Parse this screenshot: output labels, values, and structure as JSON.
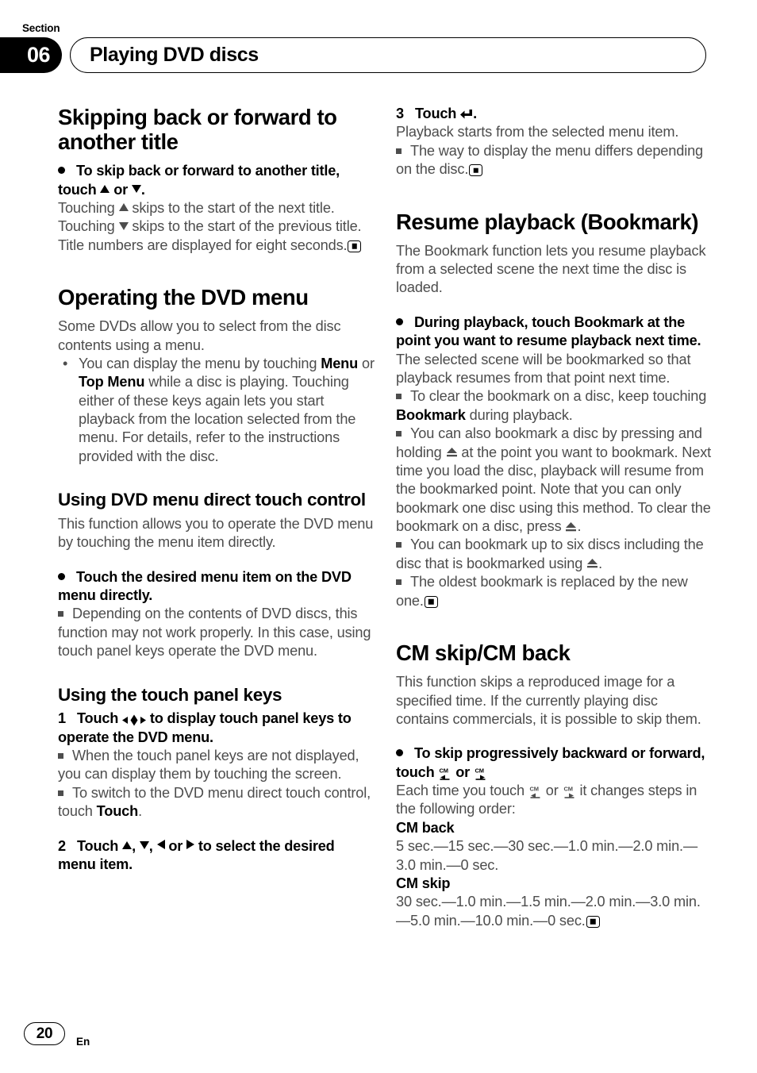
{
  "header": {
    "section_label": "Section",
    "section_number": "06",
    "title": "Playing DVD discs"
  },
  "footer": {
    "page_number": "20",
    "language": "En"
  },
  "icons": {
    "dpad": "dpad-4way-icon",
    "enter": "enter-return-icon",
    "eject": "eject-icon",
    "cm_back": "cm-back-icon",
    "cm_skip": "cm-skip-icon",
    "end_marker": "end-of-section-marker"
  },
  "colors": {
    "body_text": "#4d4d4d",
    "heading_text": "#000000",
    "tab_background": "#000000",
    "page_background": "#ffffff"
  },
  "left_column": {
    "s1": {
      "heading": "Skipping back or forward to another title",
      "instruction_lead": "To skip back or forward to another title, touch",
      "instruction_mid": "or",
      "instruction_tail": ".",
      "p1_a": "Touching",
      "p1_b": "skips to the start of the next title.",
      "p2_a": "Touching",
      "p2_b": "skips to the start of the previous title.",
      "p3": "Title numbers are displayed for eight seconds."
    },
    "s2": {
      "heading": "Operating the DVD menu",
      "p1": "Some DVDs allow you to select from the disc contents using a menu.",
      "bullet1_a": "You can display the menu by touching ",
      "bullet1_b1": "Menu",
      "bullet1_c": " or ",
      "bullet1_b2": "Top Menu",
      "bullet1_d": " while a disc is playing. Touching either of these keys again lets you start playback from the location selected from the menu. For details, refer to the instructions provided with the disc."
    },
    "s3": {
      "heading": "Using DVD menu direct touch control",
      "p1": "This function allows you to operate the DVD menu by touching the menu item directly.",
      "instruction": "Touch the desired menu item on the DVD menu directly.",
      "note1": "Depending on the contents of DVD discs, this function may not work properly. In this case, using touch panel keys operate the DVD menu."
    },
    "s4": {
      "heading": "Using the touch panel keys",
      "step1_num": "1",
      "step1_a": "Touch",
      "step1_b": "to display touch panel keys to operate the DVD menu.",
      "note1": "When the touch panel keys are not displayed, you can display them by touching the screen.",
      "note2_a": "To switch to the DVD menu direct touch control, touch ",
      "note2_bold": "Touch",
      "note2_b": ".",
      "step2_num": "2",
      "step2_a": "Touch",
      "step2_comma": ",",
      "step2_or": "or",
      "step2_b": "to select the desired menu item."
    }
  },
  "right_column": {
    "s5": {
      "step3_num": "3",
      "step3_a": "Touch",
      "step3_b": ".",
      "p1": "Playback starts from the selected menu item.",
      "note1": "The way to display the menu differs depending on the disc."
    },
    "s6": {
      "heading": "Resume playback (Bookmark)",
      "p1": "The Bookmark function lets you resume playback from a selected scene the next time the disc is loaded.",
      "instruction": "During playback, touch Bookmark at the point you want to resume playback next time.",
      "p2": "The selected scene will be bookmarked so that playback resumes from that point next time.",
      "note1_a": "To clear the bookmark on a disc, keep touching ",
      "note1_bold": "Bookmark",
      "note1_b": " during playback.",
      "note2_a": "You can also bookmark a disc by pressing and holding",
      "note2_b": "at the point you want to bookmark. Next time you load the disc, playback will resume from the bookmarked point. Note that you can only bookmark one disc using this method. To clear the bookmark on a disc, press",
      "note2_c": ".",
      "note3_a": "You can bookmark up to six discs including the disc that is bookmarked using",
      "note3_b": ".",
      "note4": "The oldest bookmark is replaced by the new one."
    },
    "s7": {
      "heading": "CM skip/CM back",
      "p1": "This function skips a reproduced image for a specified time. If the currently playing disc contains commercials, it is possible to skip them.",
      "instruction_a": "To skip progressively backward or forward, touch",
      "instruction_or": "or",
      "p2_a": "Each time you touch",
      "p2_or": "or",
      "p2_b": "it changes steps in the following order:",
      "cm_back_label": "CM back",
      "cm_back_values": "5 sec.—15 sec.—30 sec.—1.0 min.—2.0 min.—3.0 min.—0 sec.",
      "cm_skip_label": "CM skip",
      "cm_skip_values": "30 sec.—1.0 min.—1.5 min.—2.0 min.—3.0 min.—5.0 min.—10.0 min.—0 sec."
    }
  }
}
